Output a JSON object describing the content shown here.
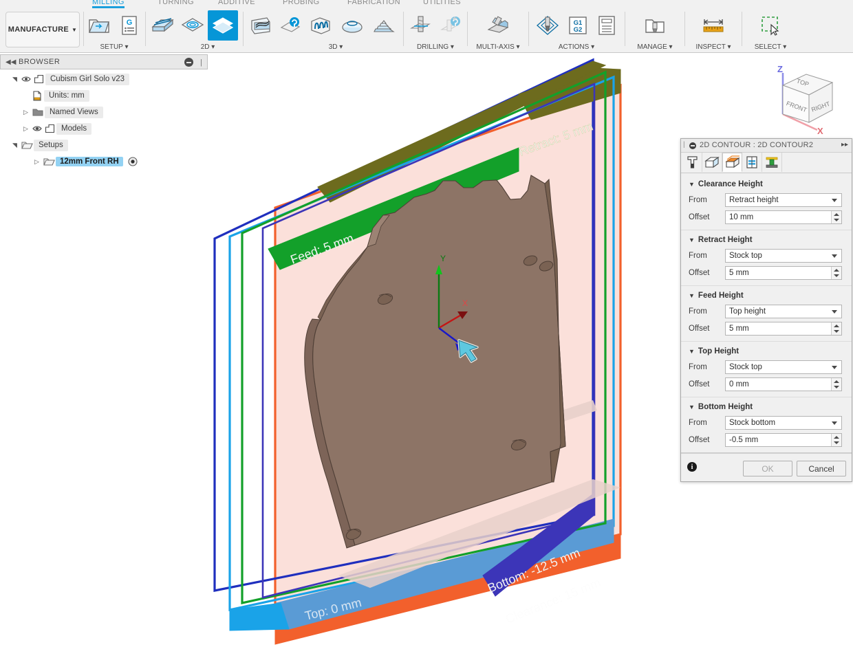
{
  "ribbon": {
    "product_menu": "MANUFACTURE",
    "tabs": [
      {
        "label": "MILLING",
        "active": true
      },
      {
        "label": "TURNING",
        "active": false
      },
      {
        "label": "ADDITIVE",
        "active": false
      },
      {
        "label": "PROBING",
        "active": false
      },
      {
        "label": "FABRICATION",
        "active": false
      },
      {
        "label": "UTILITIES",
        "active": false
      }
    ],
    "panels": [
      {
        "label": "SETUP ▾"
      },
      {
        "label": "2D ▾"
      },
      {
        "label": "3D ▾"
      },
      {
        "label": "DRILLING ▾"
      },
      {
        "label": "MULTI-AXIS ▾"
      },
      {
        "label": "ACTIONS ▾"
      },
      {
        "label": "MANAGE ▾"
      },
      {
        "label": "INSPECT ▾"
      },
      {
        "label": "SELECT ▾"
      }
    ]
  },
  "browser": {
    "title": "BROWSER",
    "tree": [
      {
        "label": "Cubism Girl Solo v23",
        "indent": 0,
        "twisty": "down",
        "eye": true,
        "icon": "component-icon",
        "selected": false
      },
      {
        "label": "Units: mm",
        "indent": 1,
        "twisty": "none",
        "eye": false,
        "icon": "units-icon",
        "selected": false
      },
      {
        "label": "Named Views",
        "indent": 1,
        "twisty": "right",
        "eye": false,
        "icon": "folder-icon",
        "selected": false
      },
      {
        "label": "Models",
        "indent": 1,
        "twisty": "right",
        "eye": true,
        "icon": "component-icon",
        "selected": false
      },
      {
        "label": "Setups",
        "indent": 1,
        "twisty": "down",
        "eye": false,
        "icon": "setup-folder-icon",
        "selected": false
      },
      {
        "label": "12mm Front RH",
        "indent": 2,
        "twisty": "right",
        "eye": false,
        "icon": "setup-folder-icon",
        "selected": true
      }
    ]
  },
  "viewport": {
    "viewcube": {
      "top": "TOP",
      "front": "FRONT",
      "right": "RIGHT",
      "z_axis": "Z",
      "x_axis": "X"
    },
    "wcs_triad": {
      "x": "X",
      "y": "Y"
    },
    "height_labels": [
      {
        "name": "retract",
        "text": "Retract: 5 mm",
        "color": "#6d6b1e"
      },
      {
        "name": "feed",
        "text": "Feed: 5 mm",
        "color": "#13a02a"
      },
      {
        "name": "bottom",
        "text": "Bottom: -12.5 mm",
        "color": "#3c35b8"
      },
      {
        "name": "clearance",
        "text": "Clearance: 15 mm",
        "color": "#f2602c"
      },
      {
        "name": "top",
        "text": "Top: 0 mm",
        "color": "#5a9bd5"
      }
    ],
    "plane_colors": {
      "clearance": "#f2602c",
      "retract": "#1f2fbe",
      "feed": "#13a02a",
      "top": "#1aa3e8",
      "bottom": "#3c35b8",
      "stock_fill": "#fbe0da",
      "model": "#8d7466"
    }
  },
  "dialog": {
    "title": "2D CONTOUR : 2D CONTOUR2",
    "tabs": [
      {
        "name": "tool-tab",
        "selected": false
      },
      {
        "name": "geometry-tab",
        "selected": false
      },
      {
        "name": "heights-tab",
        "selected": true
      },
      {
        "name": "passes-tab",
        "selected": false
      },
      {
        "name": "linking-tab",
        "selected": false
      }
    ],
    "from_label": "From",
    "offset_label": "Offset",
    "groups": [
      {
        "title": "Clearance Height",
        "from": "Retract height",
        "offset": "10 mm"
      },
      {
        "title": "Retract Height",
        "from": "Stock top",
        "offset": "5 mm"
      },
      {
        "title": "Feed Height",
        "from": "Top height",
        "offset": "5 mm"
      },
      {
        "title": "Top Height",
        "from": "Stock top",
        "offset": "0 mm"
      },
      {
        "title": "Bottom Height",
        "from": "Stock bottom",
        "offset": "-0.5 mm"
      }
    ],
    "ok_label": "OK",
    "cancel_label": "Cancel"
  }
}
